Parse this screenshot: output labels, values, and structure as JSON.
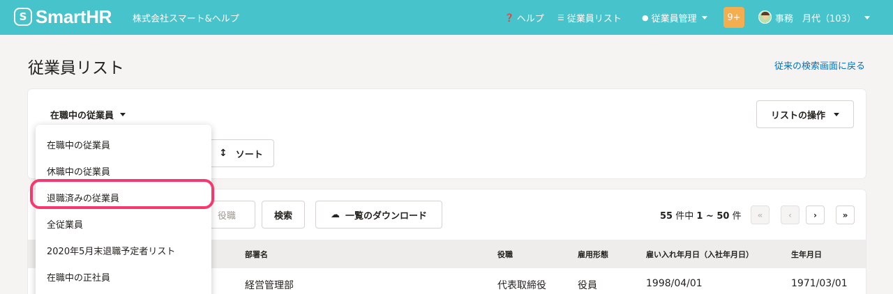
{
  "header": {
    "logo_mark": "S",
    "logo_text": "SmartHR",
    "company": "株式会社スマート&ヘルプ",
    "help_label": "ヘルプ",
    "employee_list_label": "従業員リスト",
    "employee_mgmt_label": "従業員管理",
    "notifications_badge": "9+",
    "user_name": "事務　月代（103）",
    "colors": {
      "bar": "#47c3cb",
      "badge": "#f4ad4f"
    },
    "icons": {
      "help": "question-circle-icon",
      "list": "list-icon",
      "user": "user-icon"
    }
  },
  "page": {
    "title": "従業員リスト",
    "back_link": "従来の検索画面に戻る"
  },
  "filter": {
    "selected": "在職中の従業員",
    "list_ops_label": "リストの操作",
    "sort_label": "ソート",
    "options": [
      "在職中の従業員",
      "休職中の従業員",
      "退職済みの従業員",
      "全従業員",
      "2020年5月末退職予定者リスト",
      "在職中の正社員"
    ],
    "highlighted_option": "退職済みの従業員",
    "highlight_color": "#f5396f"
  },
  "search": {
    "role_placeholder": "役職",
    "search_label": "検索",
    "download_label": "一覧のダウンロード"
  },
  "pagination": {
    "total": "55",
    "unit_of": "件中",
    "range": "1 ~ 50",
    "unit": "件",
    "first": "«",
    "prev": "‹",
    "next": "›",
    "last": "»"
  },
  "table": {
    "headers": {
      "department": "部署名",
      "role": "役職",
      "employment_type": "雇用形態",
      "hire_date": "雇い入れ年月日（入社年月日）",
      "birth_date": "生年月日"
    },
    "rows": [
      {
        "department": "経営管理部",
        "role": "代表取締役",
        "employment_type": "役員",
        "hire_date": "1998/04/01",
        "birth_date": "1971/03/01"
      }
    ]
  }
}
